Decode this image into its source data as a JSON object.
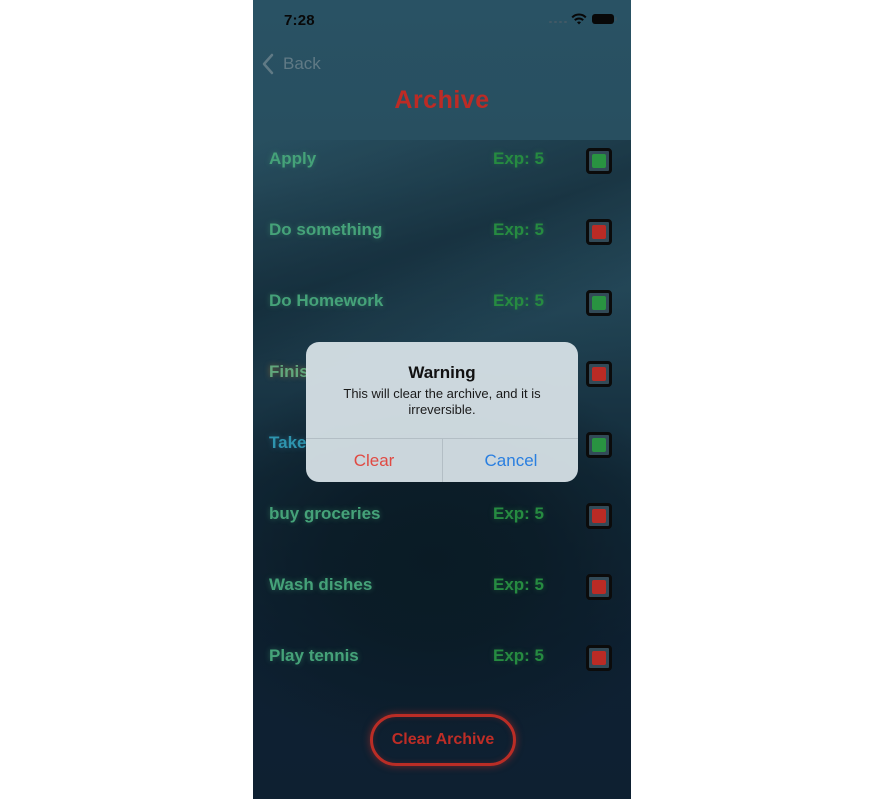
{
  "status_bar": {
    "time": "7:28"
  },
  "nav": {
    "back_label": "Back",
    "title": "Archive"
  },
  "colors": {
    "accent_red": "#d8312b",
    "done_green": "#2fa84a",
    "not_done_red": "#d4322b",
    "task_text": "#4fb98a",
    "exp_text": "#2c9f4a"
  },
  "tasks": [
    {
      "name": "Apply",
      "exp": "Exp: 5",
      "status": "done"
    },
    {
      "name": "Do something",
      "exp": "Exp: 5",
      "status": "not-done"
    },
    {
      "name": "Do Homework",
      "exp": "Exp: 5",
      "status": "done"
    },
    {
      "name": "Finis",
      "exp": "",
      "status": "not-done"
    },
    {
      "name": "Take",
      "exp": "",
      "status": "done"
    },
    {
      "name": "buy groceries",
      "exp": "Exp: 5",
      "status": "not-done"
    },
    {
      "name": "Wash dishes",
      "exp": "Exp: 5",
      "status": "not-done"
    },
    {
      "name": "Play tennis",
      "exp": "Exp: 5",
      "status": "not-done"
    }
  ],
  "alert": {
    "title": "Warning",
    "message": "This will clear the archive, and it is irreversible.",
    "clear_label": "Clear",
    "cancel_label": "Cancel"
  },
  "footer": {
    "clear_archive_label": "Clear Archive"
  }
}
